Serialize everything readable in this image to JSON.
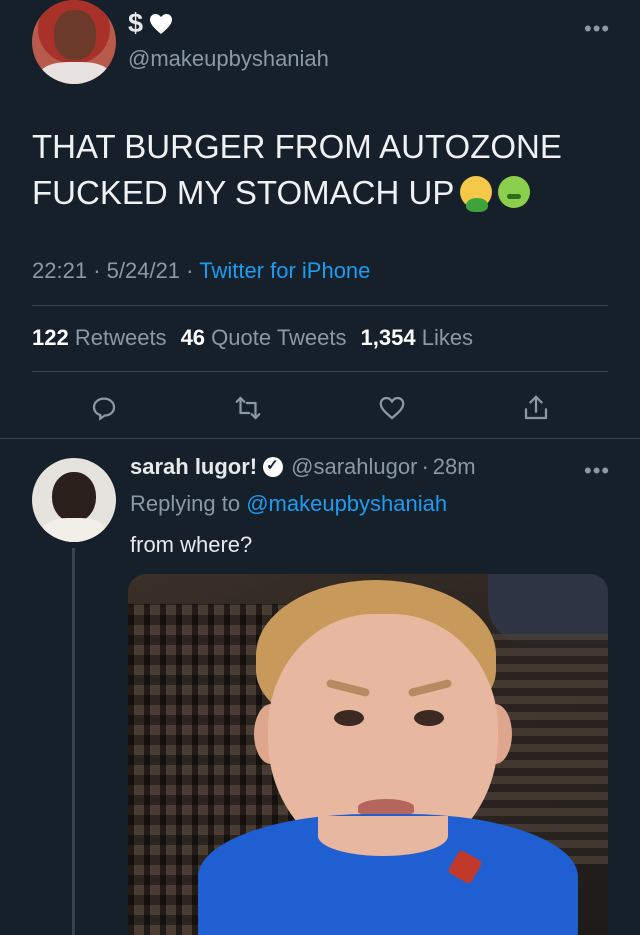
{
  "main_tweet": {
    "name_symbols": "$",
    "handle": "@makeupbyshaniah",
    "text": "THAT BURGER FROM AUTOZONE FUCKED MY STOMACH UP",
    "emojis": [
      "nauseated-face-icon",
      "face-vomiting-icon"
    ],
    "time": "22:21",
    "date": "5/24/21",
    "source": "Twitter for iPhone",
    "stats": {
      "retweets_count": "122",
      "retweets_label": "Retweets",
      "quotes_count": "46",
      "quotes_label": "Quote Tweets",
      "likes_count": "1,354",
      "likes_label": "Likes"
    },
    "actions": [
      "reply-icon",
      "retweet-icon",
      "like-icon",
      "share-icon"
    ]
  },
  "reply": {
    "name": "sarah lugor!",
    "handle": "@sarahlugor",
    "time": "28m",
    "replying_prefix": "Replying to",
    "replying_to": "@makeupbyshaniah",
    "text": "from where?",
    "has_photo": true
  },
  "separators": {
    "dot": "·"
  },
  "colors": {
    "background": "#15202b",
    "link": "#1d9bf0",
    "muted": "#8b98a5",
    "divider": "#38444d"
  }
}
